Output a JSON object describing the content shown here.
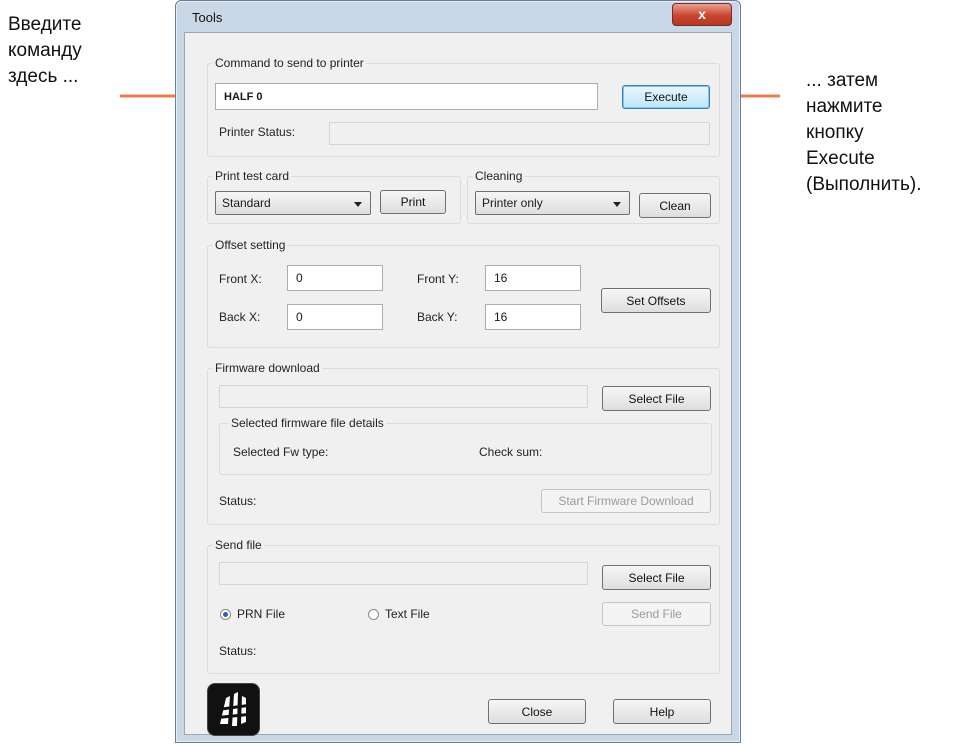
{
  "annotations": {
    "left_lines": [
      "Введите",
      "команду",
      "здесь ..."
    ],
    "right_lines": [
      "... затем",
      "нажмите",
      "кнопку",
      "Execute",
      "(Выполнить)."
    ],
    "arrow_color": "#f07a50"
  },
  "window": {
    "title": "Tools",
    "close_label": "x"
  },
  "command": {
    "group_label": "Command to send to printer",
    "value": "HALF 0",
    "execute_label": "Execute",
    "status_label": "Printer Status:",
    "status_value": ""
  },
  "test_card": {
    "group_label": "Print test card",
    "selected": "Standard",
    "print_label": "Print"
  },
  "cleaning": {
    "group_label": "Cleaning",
    "selected": "Printer only",
    "clean_label": "Clean"
  },
  "offset": {
    "group_label": "Offset setting",
    "front_x_label": "Front X:",
    "front_x_value": "0",
    "front_y_label": "Front Y:",
    "front_y_value": "16",
    "back_x_label": "Back X:",
    "back_x_value": "0",
    "back_y_label": "Back Y:",
    "back_y_value": "16",
    "set_label": "Set Offsets"
  },
  "firmware": {
    "group_label": "Firmware download",
    "path_value": "",
    "select_label": "Select File",
    "details_label": "Selected firmware file details",
    "fw_type_label": "Selected Fw type:",
    "checksum_label": "Check sum:",
    "status_label": "Status:",
    "start_label": "Start Firmware Download"
  },
  "send_file": {
    "group_label": "Send file",
    "path_value": "",
    "select_label": "Select File",
    "prn_label": "PRN File",
    "text_label": "Text File",
    "send_label": "Send File",
    "status_label": "Status:",
    "prn_selected": true
  },
  "footer": {
    "close_label": "Close",
    "help_label": "Help",
    "logo_icon": "zebra-logo-icon"
  }
}
